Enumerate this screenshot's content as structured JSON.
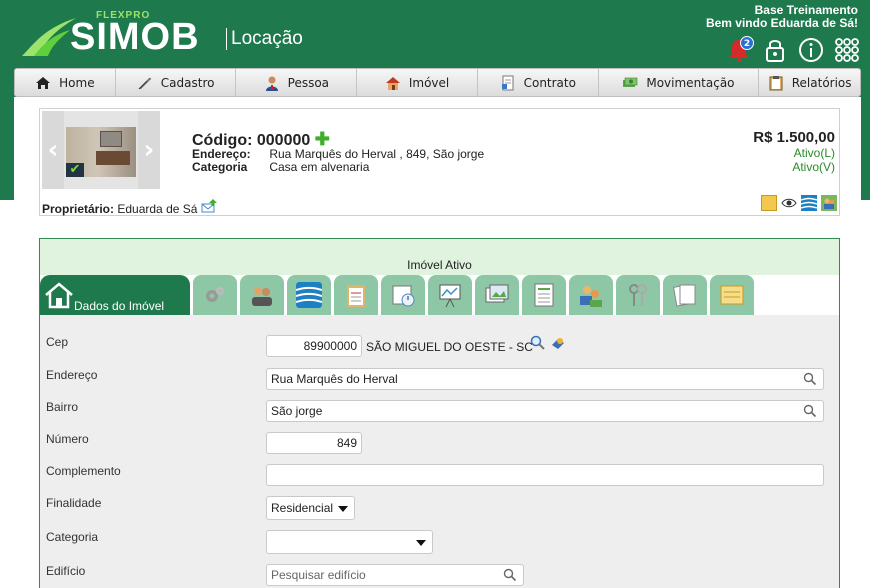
{
  "header": {
    "brand_small": "FLEXPRO",
    "brand": "SIMOB",
    "module": "Locação",
    "base": "Base Treinamento",
    "welcome": "Bem vindo Eduarda de Sá!",
    "notifications": "2",
    "icons": [
      "bell-icon",
      "lock-icon",
      "info-icon",
      "apps-grid-icon"
    ]
  },
  "nav": {
    "items": [
      {
        "label": "Home",
        "icon": "home-icon"
      },
      {
        "label": "Cadastro",
        "icon": "feather-icon"
      },
      {
        "label": "Pessoa",
        "icon": "person-icon"
      },
      {
        "label": "Imóvel",
        "icon": "house-icon"
      },
      {
        "label": "Contrato",
        "icon": "contract-icon"
      },
      {
        "label": "Movimentação",
        "icon": "money-icon"
      },
      {
        "label": "Relatórios",
        "icon": "clipboard-icon"
      }
    ]
  },
  "property": {
    "code_label": "Código:",
    "code": "000000",
    "address_label": "Endereço:",
    "address": "Rua Marquês do Herval , 849, São jorge",
    "category_label": "Categoria",
    "category": "Casa em alvenaria",
    "price": "R$ 1.500,00",
    "status_l": "Ativo(L)",
    "status_v": "Ativo(V)",
    "owner_label": "Proprietário:",
    "owner": "Eduarda de Sá"
  },
  "panel": {
    "title": "Imóvel Ativo",
    "main_tab": "Dados do Imóvel"
  },
  "form": {
    "cep_label": "Cep",
    "cep": "89900000",
    "city": "SÃO MIGUEL DO OESTE - SC",
    "endereco_label": "Endereço",
    "endereco": "Rua Marquês do Herval",
    "bairro_label": "Bairro",
    "bairro": "São jorge",
    "numero_label": "Número",
    "numero": "849",
    "complemento_label": "Complemento",
    "complemento": "",
    "finalidade_label": "Finalidade",
    "finalidade": "Residencial",
    "categoria_label": "Categoria",
    "categoria": "",
    "edificio_label": "Edifício",
    "edificio_placeholder": "Pesquisar edifício"
  },
  "colors": {
    "brand_green": "#1e7a4d",
    "tab_green": "#8ec7a6",
    "panel_head": "#dff3df"
  }
}
